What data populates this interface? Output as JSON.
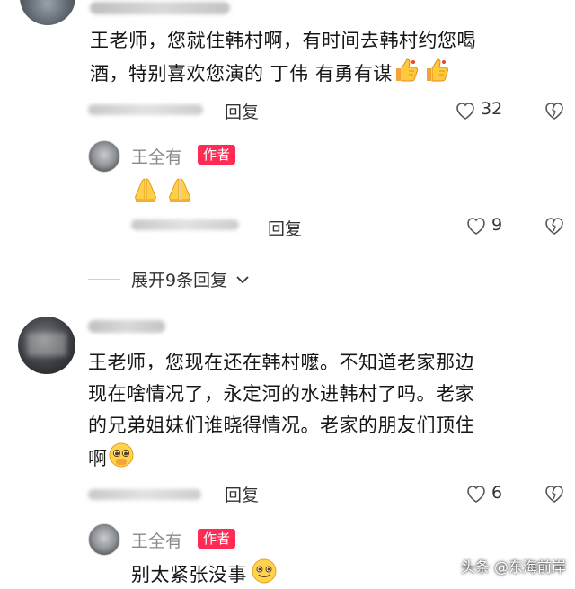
{
  "comments": [
    {
      "text": "王老师，您就住韩村啊，有时间去韩村约您喝酒，特别喜欢您演的 丁伟  有勇有谋",
      "text_line1": "王老师，您就住韩村啊，有时间去韩村约您喝",
      "text_line2": "酒，特别喜欢您演的  丁伟   有勇有谋",
      "reply_label": "回复",
      "like_count": "32",
      "emoji": [
        "thumbs-up-icon",
        "thumbs-up-icon"
      ],
      "author_reply": {
        "name": "王全有",
        "badge": "作者",
        "emoji": [
          "folded-hands-icon",
          "folded-hands-icon"
        ],
        "reply_label": "回复",
        "like_count": "9"
      },
      "expand_label": "展开9条回复"
    },
    {
      "text_line1": "王老师，您现在还在韩村嚒。不知道老家那边",
      "text_line2": "现在啥情况了，永定河的水进韩村了吗。老家",
      "text_line3": "的兄弟姐妹们谁晓得情况。老家的朋友们顶住",
      "text_line4": "啊",
      "reply_label": "回复",
      "like_count": "6",
      "emoji": [
        "pleading-face-icon"
      ],
      "author_reply": {
        "name": "王全有",
        "badge": "作者",
        "text": "别太紧张没事",
        "emoji": [
          "smiling-face-icon"
        ]
      }
    }
  ],
  "watermark": "头条 @东海前岸",
  "colors": {
    "badge": "#fe2c55",
    "muted": "#8a8a8a",
    "text": "#161616"
  }
}
